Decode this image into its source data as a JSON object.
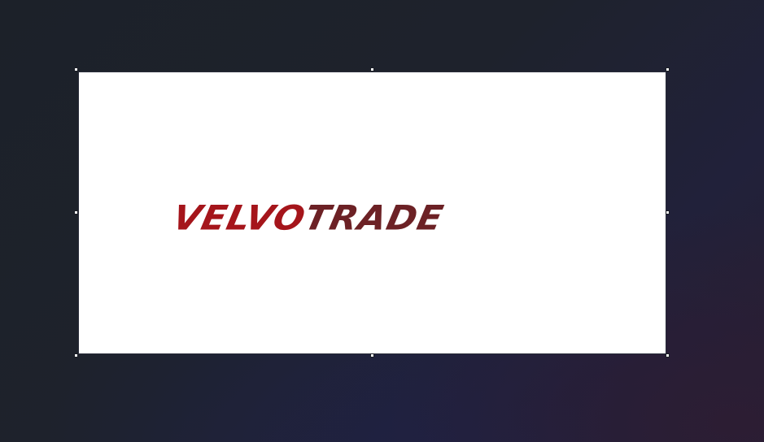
{
  "logo": {
    "text_part_1": "VELVO",
    "text_part_2": "TRADE"
  },
  "colors": {
    "logo_red": "#a5151b",
    "logo_dark_red": "#6c2125",
    "canvas_background": "#ffffff",
    "workspace_background": "#1d2129"
  }
}
